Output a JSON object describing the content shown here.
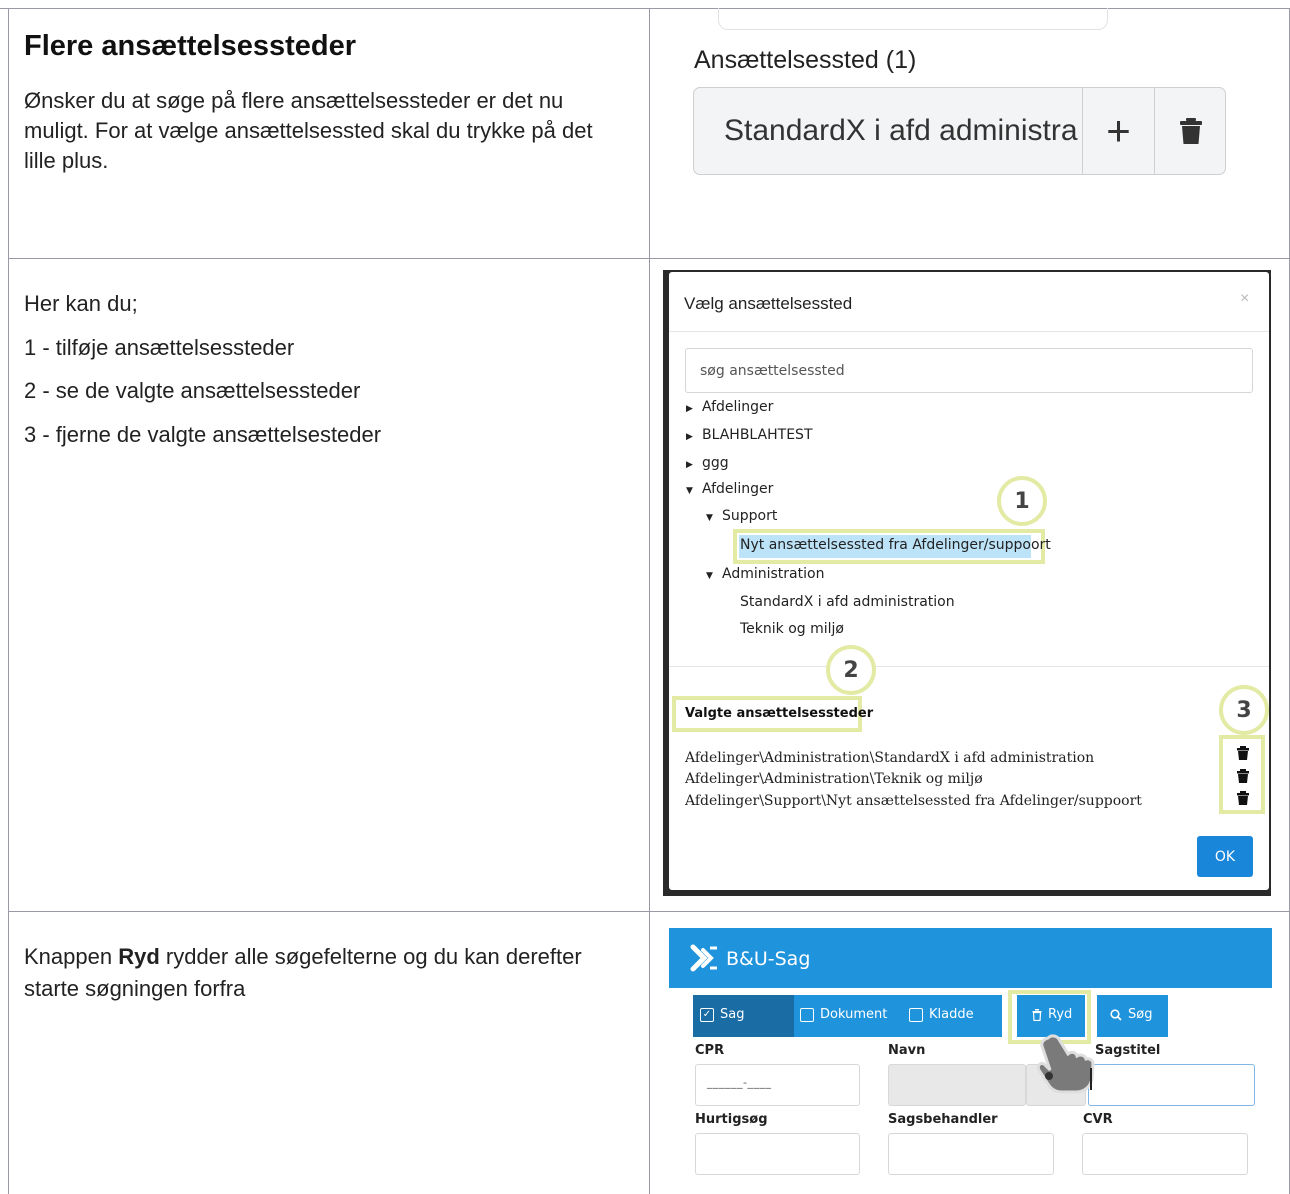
{
  "row1": {
    "heading": "Flere ansættelsessteder",
    "paragraph": "Ønsker du at søge på flere ansættelsessteder er det nu muligt. For at vælge ansættelsessted skal du trykke på det lille plus.",
    "field_label": "Ansættelsessted (1)",
    "field_value": "StandardX i afd administra",
    "plus_glyph": "+",
    "icons": [
      "trash-icon"
    ]
  },
  "row2": {
    "intro": "Her kan du;",
    "steps": [
      "1 - tilføje ansættelsessteder",
      "2 - se de valgte ansættelsessteder",
      "3 - fjerne de valgte ansættelsesteder"
    ],
    "modal": {
      "title": "Vælg ansættelsessted",
      "close": "×",
      "search_placeholder": "søg ansættelsessted",
      "tree": [
        {
          "label": "Afdelinger",
          "expanded": false
        },
        {
          "label": "BLAHBLAHTEST",
          "expanded": false
        },
        {
          "label": "ggg",
          "expanded": false
        },
        {
          "label": "Afdelinger",
          "expanded": true
        },
        {
          "label": "Support",
          "expanded": true
        },
        {
          "label": "Nyt ansættelsessted fra Afdelinger/suppoort",
          "selected": true
        },
        {
          "label": "Administration",
          "expanded": true
        },
        {
          "label": "StandardX i afd administration"
        },
        {
          "label": "Teknik og miljø"
        }
      ],
      "badges": [
        "1",
        "2",
        "3"
      ],
      "selected_heading": "Valgte ansættelsessteder",
      "selected_items": [
        "Afdelinger\\Administration\\StandardX i afd administration",
        "Afdelinger\\Administration\\Teknik og miljø",
        "Afdelinger\\Support\\Nyt ansættelsessted fra Afdelinger/suppoort"
      ],
      "ok_label": "OK"
    }
  },
  "row3": {
    "text_before": "Knappen ",
    "text_bold": "Ryd",
    "text_after": " rydder alle søgefelterne og du kan derefter starte søgningen forfra",
    "app_title": "B&U-Sag",
    "toolbar": {
      "sag": "Sag",
      "dokument": "Dokument",
      "kladde": "Kladde",
      "ryd": "Ryd",
      "sog": "Søg"
    },
    "fields": {
      "cpr": "CPR",
      "navn": "Navn",
      "sagstitel": "Sagstitel",
      "hurtigsog": "Hurtigsøg",
      "sagsbehandler": "Sagsbehandler",
      "cvr": "CVR",
      "cpr_mask": "______-____"
    },
    "colors": {
      "header_blue": "#1f93db",
      "active_tab": "#1a6ca5",
      "highlight": "#e3eaa4"
    }
  }
}
